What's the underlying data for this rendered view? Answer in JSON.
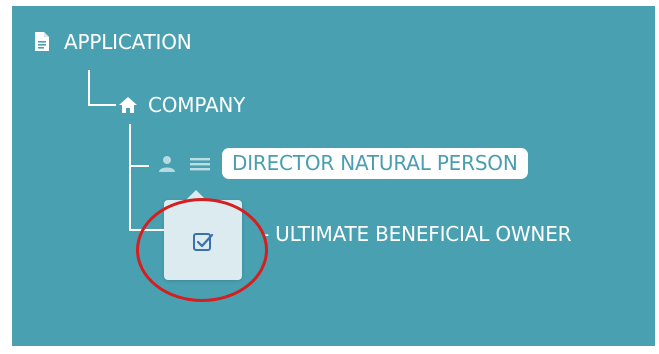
{
  "tree": {
    "root": {
      "label": "APPLICATION",
      "icon": "document-icon"
    },
    "company": {
      "label": "COMPANY",
      "icon": "home-icon"
    },
    "director": {
      "label": "DIRECTOR NATURAL PERSON",
      "icons": [
        "person-icon",
        "drag-handle-icon"
      ],
      "selected": true
    },
    "ubo": {
      "label": "- ULTIMATE BENEFICIAL OWNER"
    }
  },
  "popover": {
    "action_icon": "checkbox-check-icon"
  },
  "annotation": {
    "shape": "circle",
    "color": "#d61e1e"
  },
  "colors": {
    "background": "#49a0b0",
    "text": "#ffffff",
    "selected_text": "#4b9eb0",
    "popover": "#dcebf0"
  }
}
